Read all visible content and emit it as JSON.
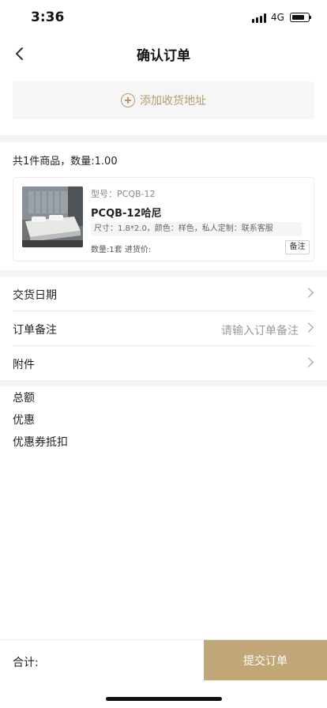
{
  "status_bar": {
    "time": "3:36",
    "network": "4G",
    "battery_level": 0.8
  },
  "nav": {
    "title": "确认订单",
    "back_icon": "chevron-left-icon"
  },
  "address": {
    "add_label": "添加收货地址",
    "icon": "plus-circle-icon"
  },
  "order": {
    "summary": "共1件商品，数量:1.00",
    "product": {
      "model": "型号：PCQB-12",
      "name": "PCQB-12哈尼",
      "spec": "尺寸：1.8*2.0，颜色：样色，私人定制：联系客服",
      "qty_price": "数量:1套 进货价:",
      "remark_label": "备注"
    }
  },
  "rows": [
    {
      "label": "交货日期",
      "placeholder": ""
    },
    {
      "label": "订单备注",
      "placeholder": "请输入订单备注"
    },
    {
      "label": "附件",
      "placeholder": ""
    }
  ],
  "summary": {
    "total": "总额",
    "discount": "优惠",
    "coupon": "优惠券抵扣"
  },
  "footer": {
    "total_label": "合计:",
    "submit_label": "提交订单"
  },
  "colors": {
    "accent": "#c1a777",
    "accent_text": "#b89a6c"
  }
}
